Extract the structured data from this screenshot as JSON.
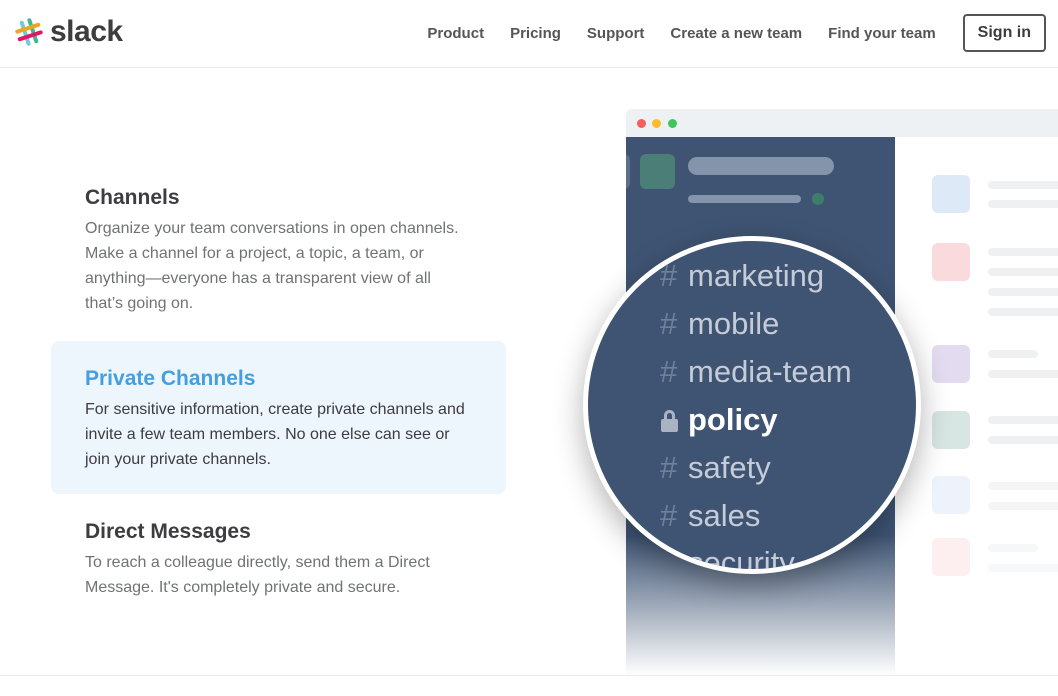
{
  "header": {
    "logo_text": "slack",
    "nav": [
      "Product",
      "Pricing",
      "Support",
      "Create a new team",
      "Find your team"
    ],
    "signin_label": "Sign in"
  },
  "features": [
    {
      "title": "Channels",
      "description": "Organize your team conversations in open channels. Make a channel for a project, a topic, a team, or anything—everyone has a transparent view of all that’s going on."
    },
    {
      "title": "Private Channels",
      "description": "For sensitive information, create private channels and invite a few team members. No one else can see or join your private channels."
    },
    {
      "title": "Direct Messages",
      "description": "To reach a colleague directly, send them a Direct Message. It's completely private and secure."
    }
  ],
  "magnifier": {
    "hash_symbol": "#",
    "channels": [
      {
        "name": "marketing",
        "private": false,
        "active": false
      },
      {
        "name": "mobile",
        "private": false,
        "active": false
      },
      {
        "name": "media-team",
        "private": false,
        "active": false
      },
      {
        "name": "policy",
        "private": true,
        "active": true
      },
      {
        "name": "safety",
        "private": false,
        "active": false
      },
      {
        "name": "sales",
        "private": false,
        "active": false
      },
      {
        "name": "security",
        "private": false,
        "active": false
      }
    ]
  },
  "colors": {
    "sidebar": "#3f5473",
    "highlight_bg": "#edf5fd",
    "highlight_title": "#439fe0",
    "msg_avatars": [
      "#dde9f7",
      "#fadadd",
      "#e3dbef",
      "#d8e6e3",
      "#eef3fb",
      "#fdeeef"
    ]
  }
}
